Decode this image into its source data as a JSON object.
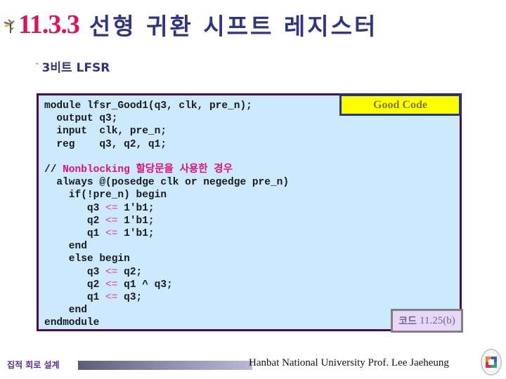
{
  "title": {
    "number": "11.3.3",
    "text": "선형 귀환 시프트 레지스터",
    "number_color": "#e0105a",
    "text_color": "#2e3586"
  },
  "subtitle": {
    "bullet_icon": "arrow-up-bullet-icon",
    "text": "3비트 LFSR"
  },
  "code": {
    "lines": [
      [
        {
          "t": "module lfsr_Good1(q3, clk, pre_n);"
        }
      ],
      [
        {
          "t": "  output q3;"
        }
      ],
      [
        {
          "t": "  input  clk, pre_n;"
        }
      ],
      [
        {
          "t": "  reg    q3, q2, q1;"
        }
      ],
      [
        {
          "t": ""
        }
      ],
      [
        {
          "t": "// "
        },
        {
          "t": "Nonblocking 할당문을 사용한 경우",
          "c": "cm"
        }
      ],
      [
        {
          "t": "  always @(posedge clk or negedge pre_n)"
        }
      ],
      [
        {
          "t": "    if(!pre_n) begin"
        }
      ],
      [
        {
          "t": "       q3 "
        },
        {
          "t": "<=",
          "c": "op"
        },
        {
          "t": " 1'b1;"
        }
      ],
      [
        {
          "t": "       q2 "
        },
        {
          "t": "<=",
          "c": "op"
        },
        {
          "t": " 1'b1;"
        }
      ],
      [
        {
          "t": "       q1 "
        },
        {
          "t": "<=",
          "c": "op"
        },
        {
          "t": " 1'b1;"
        }
      ],
      [
        {
          "t": "    end"
        }
      ],
      [
        {
          "t": "    else begin"
        }
      ],
      [
        {
          "t": "       q3 "
        },
        {
          "t": "<=",
          "c": "op"
        },
        {
          "t": " q2;"
        }
      ],
      [
        {
          "t": "       q2 "
        },
        {
          "t": "<=",
          "c": "op"
        },
        {
          "t": " q1 ^ q3;"
        }
      ],
      [
        {
          "t": "       q1 "
        },
        {
          "t": "<=",
          "c": "op"
        },
        {
          "t": " q3;"
        }
      ],
      [
        {
          "t": "    end"
        }
      ],
      [
        {
          "t": "endmodule"
        }
      ]
    ]
  },
  "badge": {
    "label": "Good Code"
  },
  "code_label": {
    "prefix": "코드",
    "number": "11.25(b)"
  },
  "footer": {
    "course": "집적 회로 설계",
    "credit": "Hanbat National University Prof. Lee Jaeheung",
    "emblem_icon": "university-emblem-icon"
  }
}
